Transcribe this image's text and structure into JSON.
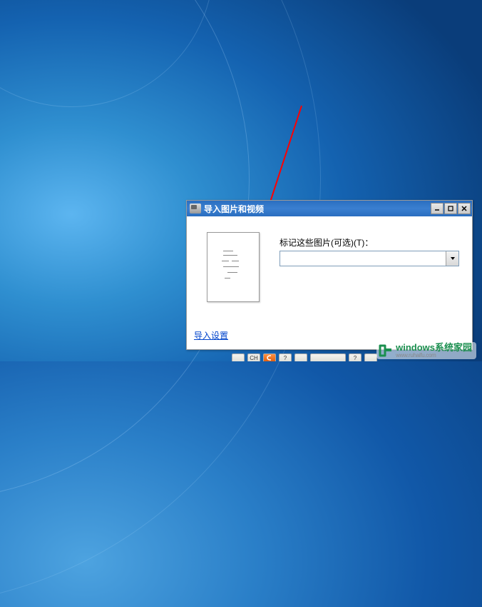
{
  "dialog": {
    "title": "导入图片和视频",
    "tag_label": "标记这些图片(可选)(T)：",
    "tag_value": "",
    "import_settings": "导入设置"
  },
  "colors": {
    "link": "#0044cc",
    "titlebar": "#2a6ec0",
    "arrow": "#ff0000"
  },
  "watermark": {
    "main": "windows系统家园",
    "sub": "www.ruhaifu.com"
  },
  "taskbar": {
    "ch": "CH",
    "help": "?",
    "help2": "?"
  }
}
